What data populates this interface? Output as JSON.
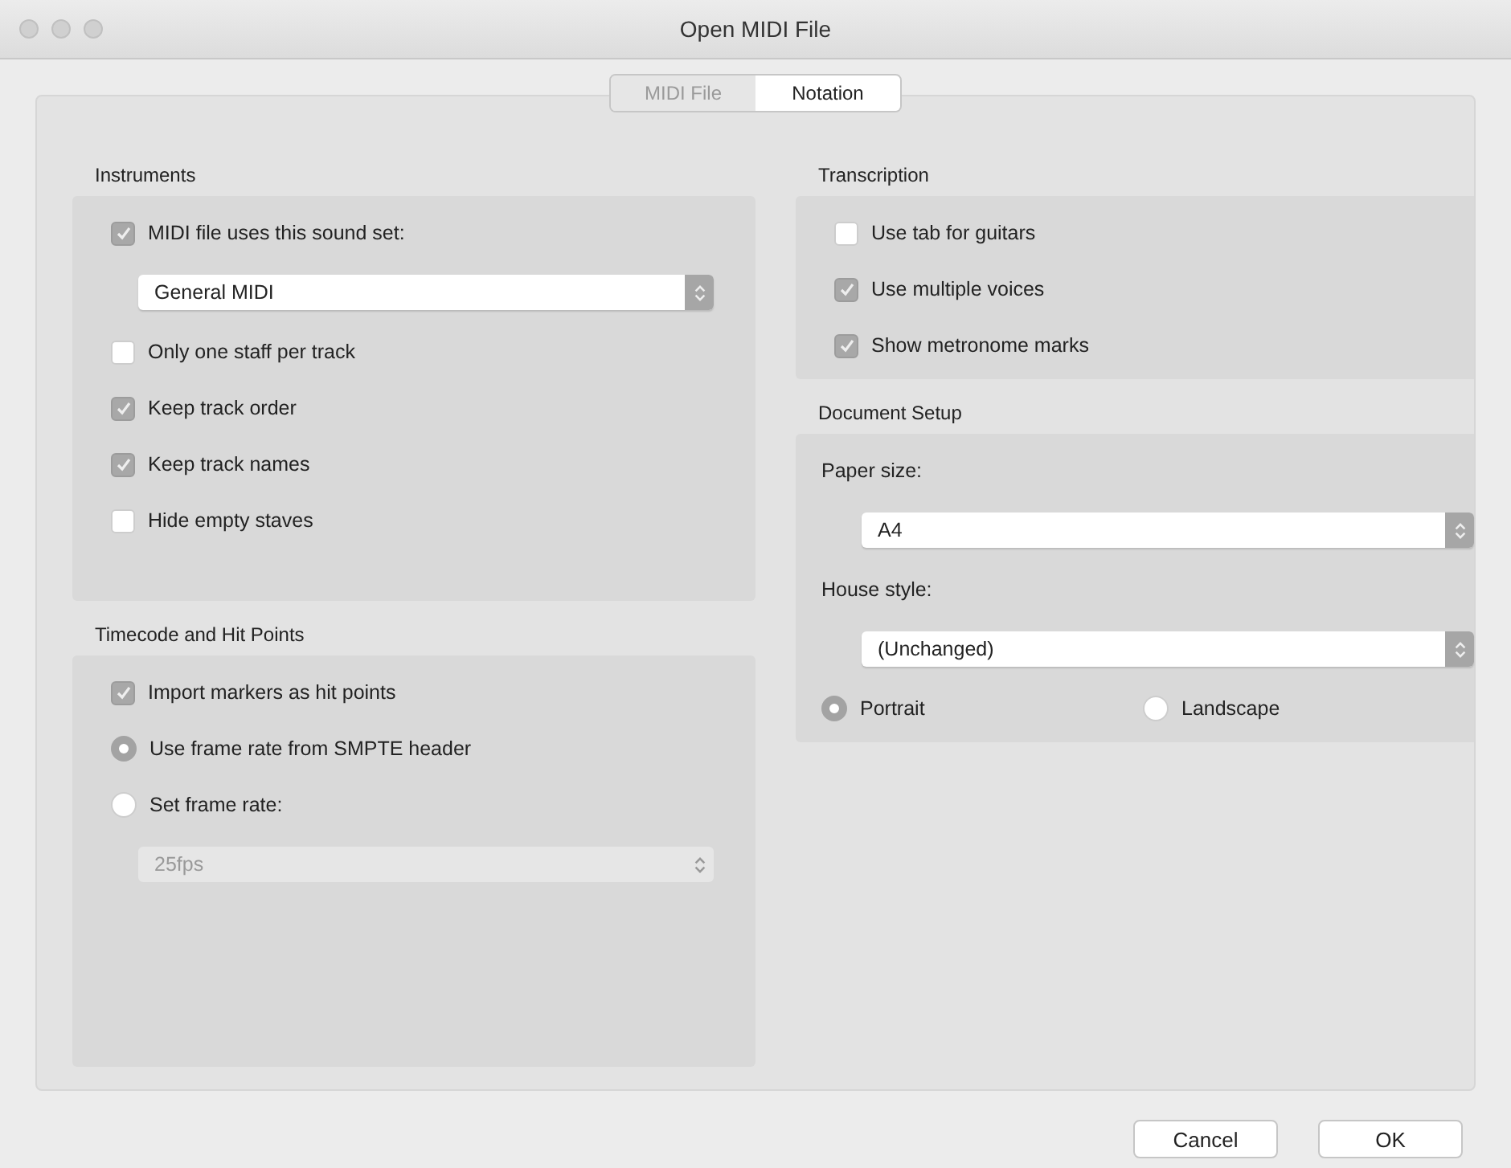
{
  "window": {
    "title": "Open MIDI File"
  },
  "tabs": [
    {
      "label": "MIDI File",
      "selected": false
    },
    {
      "label": "Notation",
      "selected": true
    }
  ],
  "columns": [
    {
      "groups": [
        {
          "title": "Instruments",
          "items": [
            {
              "kind": "checkbox",
              "label": "MIDI file uses this sound set:",
              "checked": true
            },
            {
              "kind": "select",
              "value": "General MIDI",
              "disabled": false
            },
            {
              "kind": "checkbox",
              "label": "Only one staff per track",
              "checked": false
            },
            {
              "kind": "checkbox",
              "label": "Keep track order",
              "checked": true
            },
            {
              "kind": "checkbox",
              "label": "Keep track names",
              "checked": true
            },
            {
              "kind": "checkbox",
              "label": "Hide empty staves",
              "checked": false
            }
          ]
        },
        {
          "title": "Timecode and Hit Points",
          "items": [
            {
              "kind": "checkbox",
              "label": "Import markers as hit points",
              "checked": true
            },
            {
              "kind": "radio",
              "label": "Use frame rate from SMPTE header",
              "selected": true
            },
            {
              "kind": "radio",
              "label": "Set frame rate:",
              "selected": false
            },
            {
              "kind": "select",
              "value": "25fps",
              "disabled": true
            }
          ]
        }
      ]
    },
    {
      "groups": [
        {
          "title": "Transcription",
          "items": [
            {
              "kind": "checkbox",
              "label": "Use tab for guitars",
              "checked": false
            },
            {
              "kind": "checkbox",
              "label": "Use multiple voices",
              "checked": true
            },
            {
              "kind": "checkbox",
              "label": "Show metronome marks",
              "checked": true
            }
          ]
        },
        {
          "title": "Document Setup",
          "items": [
            {
              "kind": "label",
              "label": "Paper size:"
            },
            {
              "kind": "select",
              "value": "A4",
              "disabled": false
            },
            {
              "kind": "label",
              "label": "House style:"
            },
            {
              "kind": "select",
              "value": "(Unchanged)",
              "disabled": false
            },
            {
              "kind": "radio_row",
              "options": [
                {
                  "label": "Portrait",
                  "selected": true
                },
                {
                  "label": "Landscape",
                  "selected": false
                }
              ]
            }
          ]
        }
      ]
    }
  ],
  "buttons": [
    {
      "label": "Cancel"
    },
    {
      "label": "OK"
    }
  ]
}
